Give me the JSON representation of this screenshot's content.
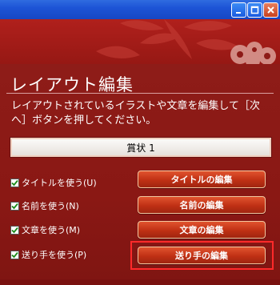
{
  "window": {
    "controls": {
      "minimize_icon": "minimize-icon",
      "maximize_icon": "maximize-icon",
      "close_icon": "close-icon"
    }
  },
  "colors": {
    "titlebar": "#1d54d6",
    "panel": "#8d1a17",
    "button": "#c8401e",
    "highlight": "#ff2a2a"
  },
  "main": {
    "heading": "レイアウト編集",
    "description": "レイアウトされているイラストや文章を編集して［次へ］ボタンを押してください。",
    "name_value": "賞状 1"
  },
  "options": [
    {
      "label": "タイトルを使う(U)",
      "checked": true,
      "button": "タイトルの編集"
    },
    {
      "label": "名前を使う(N)",
      "checked": true,
      "button": "名前の編集"
    },
    {
      "label": "文章を使う(M)",
      "checked": true,
      "button": "文章の編集"
    },
    {
      "label": "送り手を使う(P)",
      "checked": true,
      "button": "送り手の編集"
    }
  ]
}
